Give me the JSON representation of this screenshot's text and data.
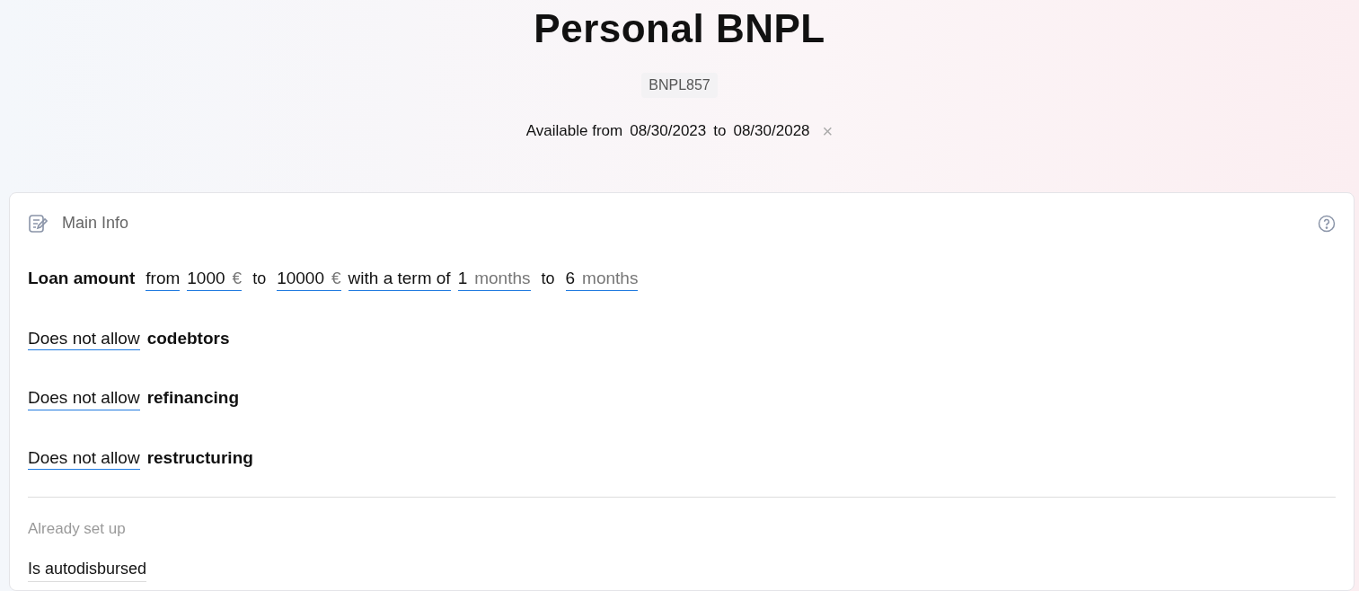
{
  "title": "Personal BNPL",
  "code": "BNPL857",
  "availability": {
    "label": "Available from",
    "start": "08/30/2023",
    "joiner": "to",
    "end": "08/30/2028",
    "clear": "×"
  },
  "section": {
    "title": "Main Info",
    "loan_terms": {
      "label": "Loan amount",
      "parts": [
        {
          "kind": "select",
          "text": "from"
        },
        {
          "kind": "field",
          "value": "1000",
          "unit": "€"
        },
        {
          "kind": "text",
          "text": "to"
        },
        {
          "kind": "field",
          "value": "10000",
          "unit": "€"
        },
        {
          "kind": "select",
          "text": "with a term of"
        },
        {
          "kind": "field",
          "value": "1",
          "unit": "months"
        },
        {
          "kind": "text",
          "text": "to"
        },
        {
          "kind": "field",
          "value": "6",
          "unit": "months"
        }
      ]
    },
    "permissions": [
      {
        "setting": "Does not allow",
        "feature": "codebtors"
      },
      {
        "setting": "Does not allow",
        "feature": "refinancing"
      },
      {
        "setting": "Does not allow",
        "feature": "restructuring"
      }
    ],
    "already_set_up": {
      "heading": "Already set up",
      "items": [
        "Is autodisbursed"
      ]
    }
  }
}
